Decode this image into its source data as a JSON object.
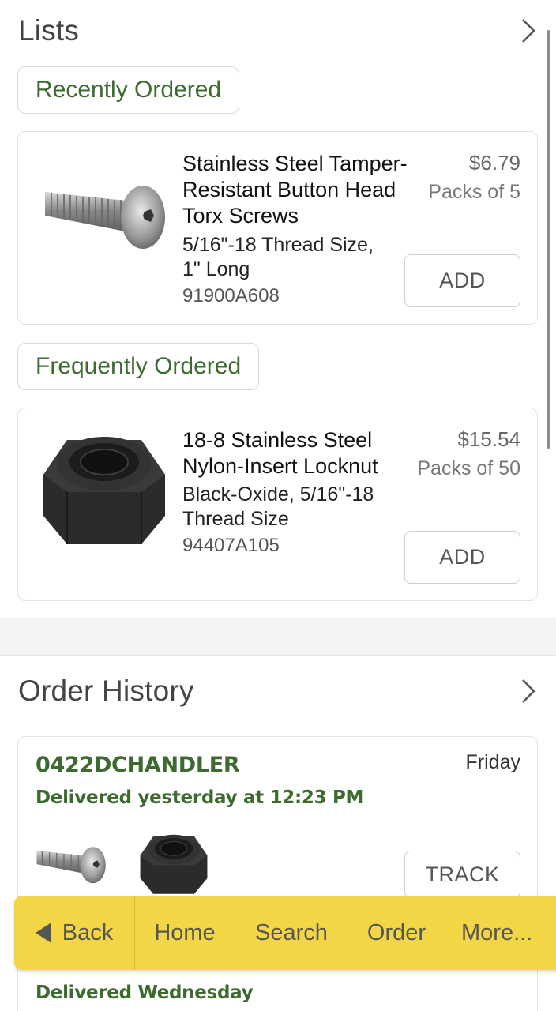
{
  "lists": {
    "title": "Lists",
    "recent_label": "Recently Ordered",
    "frequent_label": "Frequently Ordered",
    "recent_item": {
      "name": "Stainless Steel Tamper-Resistant Button Head Torx Screws",
      "name_lines": [
        "Stainless Steel Tamper-",
        "Resistant Button Head",
        "Torx Screws"
      ],
      "desc_lines": [
        "5/16\"-18 Thread Size,",
        "1\" Long"
      ],
      "part": "91900A608",
      "price": "$6.79",
      "pack": "Packs of 5",
      "button": "ADD"
    },
    "frequent_item": {
      "name_lines": [
        "18-8 Stainless Steel",
        "Nylon-Insert Locknut"
      ],
      "desc_lines": [
        "Black-Oxide, 5/16\"-18",
        "Thread Size"
      ],
      "part": "94407A105",
      "price": "$15.54",
      "pack": "Packs of 50",
      "button": "ADD"
    }
  },
  "order_history": {
    "title": "Order History",
    "order": {
      "id": "0422DCHANDLER",
      "status": "Delivered yesterday at 12:23 PM",
      "day": "Friday",
      "button": "TRACK"
    },
    "next_status": "Delivered Wednesday"
  },
  "toolbar": {
    "back": "Back",
    "home": "Home",
    "search": "Search",
    "order": "Order",
    "more": "More..."
  },
  "colors": {
    "accent_green": "#3d6b2f",
    "toolbar_yellow": "#f3d646"
  }
}
